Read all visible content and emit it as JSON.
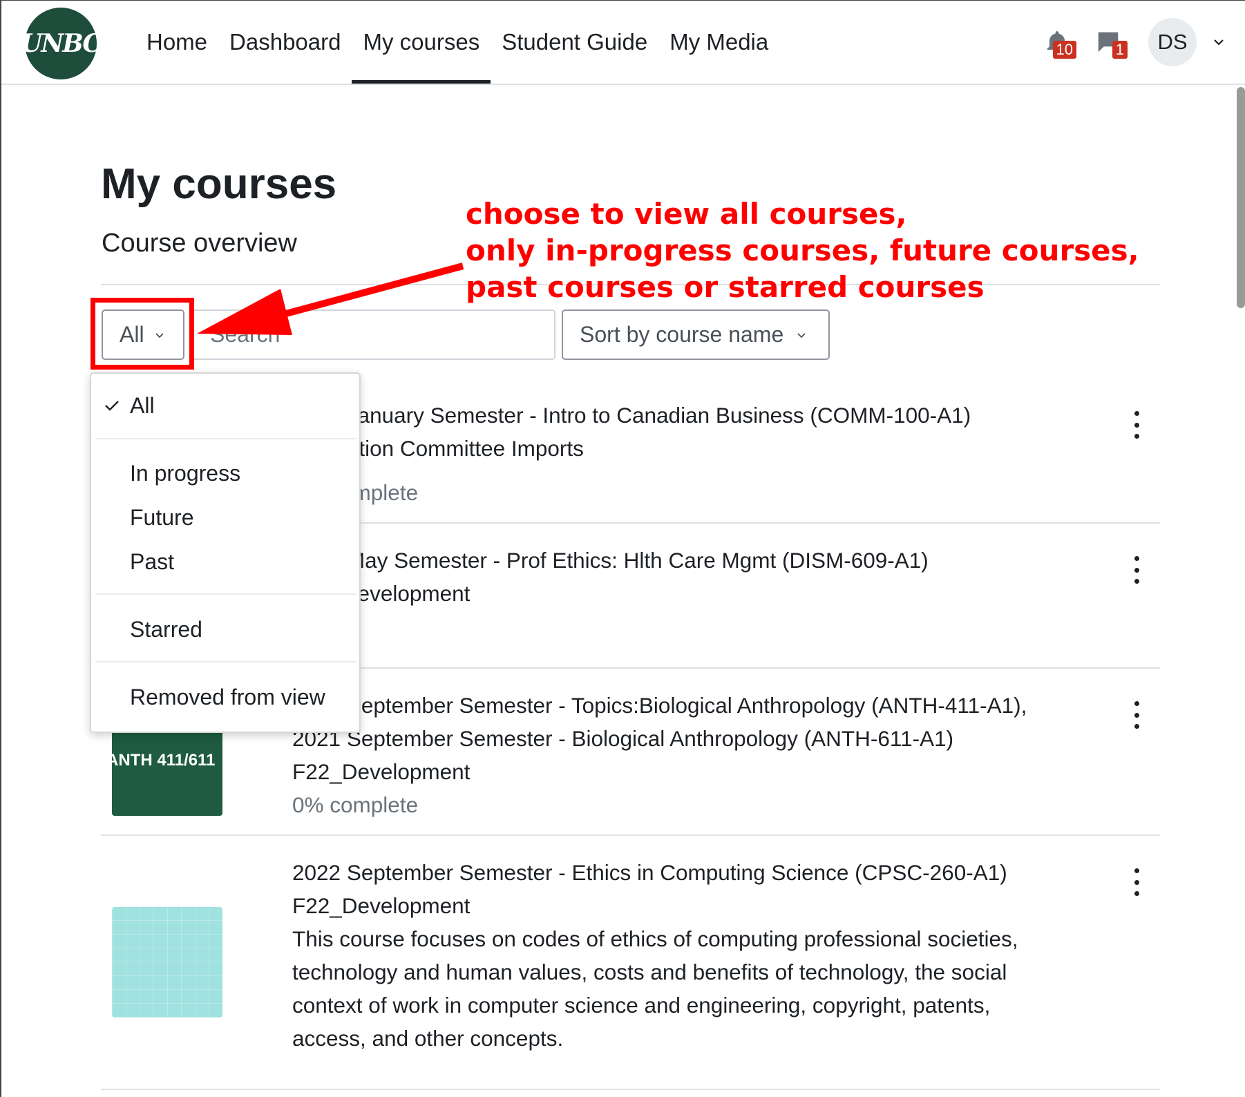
{
  "nav": {
    "logo_text": "UNBC",
    "links": [
      "Home",
      "Dashboard",
      "My courses",
      "Student Guide",
      "My Media"
    ],
    "notifications_count": "10",
    "messages_count": "1",
    "user_initials": "DS"
  },
  "page": {
    "title": "My courses",
    "section_title": "Course overview"
  },
  "controls": {
    "grouping_label": "All",
    "search_placeholder": "Search",
    "sort_label": "Sort by course name"
  },
  "dropdown": {
    "items": [
      "All",
      "In progress",
      "Future",
      "Past",
      "Starred",
      "Removed from view"
    ],
    "selected": "All"
  },
  "annotation": {
    "line1": "choose to view all courses,",
    "line2": "only in-progress courses, future courses,",
    "line3": "past courses or starred courses",
    "color": "#ff0000"
  },
  "courses": [
    {
      "title": "2023 January Semester - Intro to Canadian Business (COMM-100-A1)",
      "category": "Evaluation Committee Imports",
      "progress": "0% complete"
    },
    {
      "title": "2022 May Semester - Prof Ethics: Hlth Care Mgmt (DISM-609-A1)",
      "category": "F22_Development"
    },
    {
      "title": "2021 September Semester - Topics:Biological Anthropology (ANTH-411-A1),",
      "title2": "2021 September Semester - Biological Anthropology (ANTH-611-A1)",
      "category": "F22_Development",
      "progress": "0% complete",
      "image_text": "ANTH 411/611"
    },
    {
      "title": "2022 September Semester - Ethics in Computing Science (CPSC-260-A1)",
      "category": "F22_Development",
      "summary": [
        "This course focuses on codes of ethics of computing professional societies,",
        "technology and human values, costs and benefits of technology, the social",
        "context of work in computer science and engineering, copyright, patents,",
        "access, and other concepts."
      ]
    }
  ],
  "colors": {
    "brand_green": "#1e4d3b",
    "badge_red": "#ca3120",
    "annotation_red": "#ff0000"
  }
}
